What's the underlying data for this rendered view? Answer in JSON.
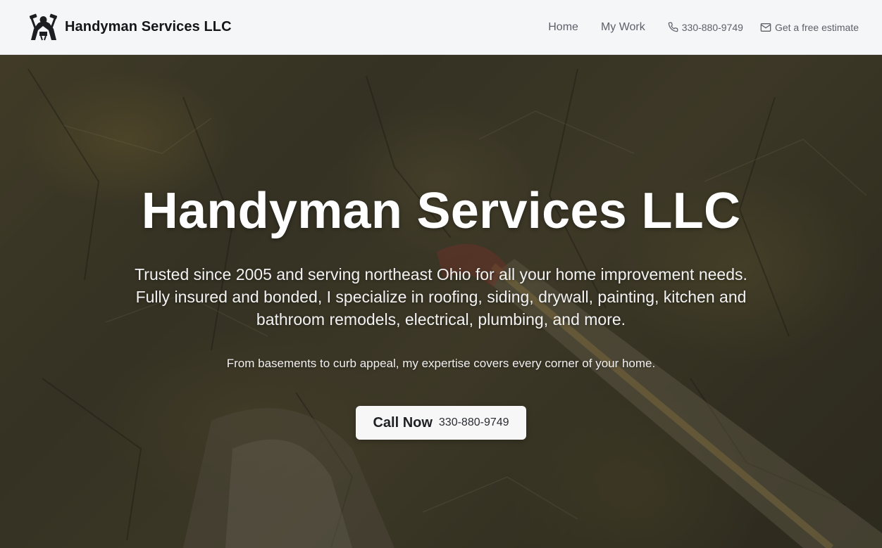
{
  "header": {
    "brand_name": "Handyman Services LLC",
    "logo_icon": "handyman-logo-icon",
    "nav": [
      {
        "label": "Home"
      },
      {
        "label": "My Work"
      }
    ],
    "phone": {
      "icon": "phone-icon",
      "label": "330-880-9749"
    },
    "estimate": {
      "icon": "mail-icon",
      "label": "Get a free estimate"
    }
  },
  "hero": {
    "title": "Handyman Services LLC",
    "lead": "Trusted since 2005 and serving northeast Ohio for all your home improvement needs. Fully insured and bonded, I specialize in roofing, siding, drywall, painting, kitchen and bathroom remodels, electrical, plumbing, and more.",
    "sub": "From basements to curb appeal, my expertise covers every corner of your home.",
    "cta": {
      "label": "Call Now",
      "phone": "330-880-9749"
    }
  },
  "colors": {
    "header_bg": "#f5f6f8",
    "brand_text": "#15161a",
    "nav_text": "#5d6069",
    "hero_text": "#ffffff",
    "cta_bg": "#f7f7f8",
    "cta_text": "#1f2024"
  }
}
